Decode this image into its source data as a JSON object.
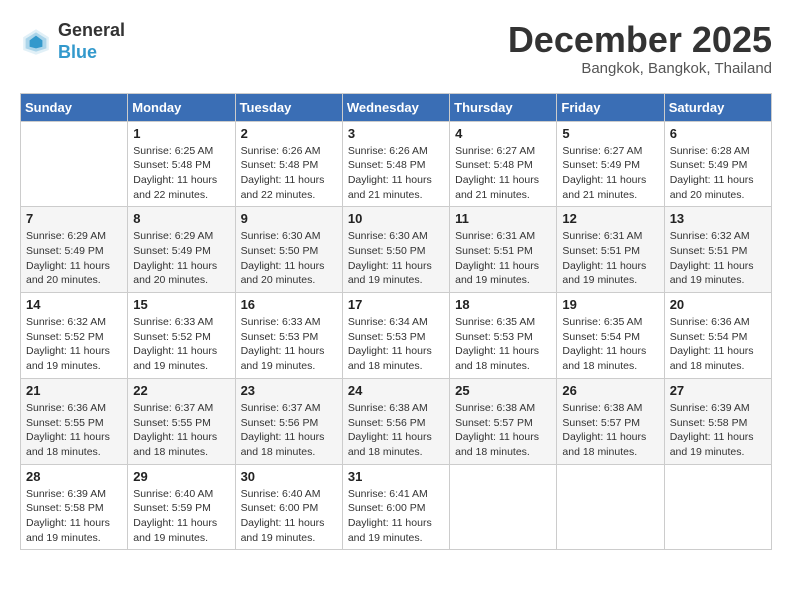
{
  "header": {
    "logo_general": "General",
    "logo_blue": "Blue",
    "title": "December 2025",
    "location": "Bangkok, Bangkok, Thailand"
  },
  "calendar": {
    "days_of_week": [
      "Sunday",
      "Monday",
      "Tuesday",
      "Wednesday",
      "Thursday",
      "Friday",
      "Saturday"
    ],
    "weeks": [
      [
        {
          "num": "",
          "info": ""
        },
        {
          "num": "1",
          "info": "Sunrise: 6:25 AM\nSunset: 5:48 PM\nDaylight: 11 hours\nand 22 minutes."
        },
        {
          "num": "2",
          "info": "Sunrise: 6:26 AM\nSunset: 5:48 PM\nDaylight: 11 hours\nand 22 minutes."
        },
        {
          "num": "3",
          "info": "Sunrise: 6:26 AM\nSunset: 5:48 PM\nDaylight: 11 hours\nand 21 minutes."
        },
        {
          "num": "4",
          "info": "Sunrise: 6:27 AM\nSunset: 5:48 PM\nDaylight: 11 hours\nand 21 minutes."
        },
        {
          "num": "5",
          "info": "Sunrise: 6:27 AM\nSunset: 5:49 PM\nDaylight: 11 hours\nand 21 minutes."
        },
        {
          "num": "6",
          "info": "Sunrise: 6:28 AM\nSunset: 5:49 PM\nDaylight: 11 hours\nand 20 minutes."
        }
      ],
      [
        {
          "num": "7",
          "info": "Sunrise: 6:29 AM\nSunset: 5:49 PM\nDaylight: 11 hours\nand 20 minutes."
        },
        {
          "num": "8",
          "info": "Sunrise: 6:29 AM\nSunset: 5:49 PM\nDaylight: 11 hours\nand 20 minutes."
        },
        {
          "num": "9",
          "info": "Sunrise: 6:30 AM\nSunset: 5:50 PM\nDaylight: 11 hours\nand 20 minutes."
        },
        {
          "num": "10",
          "info": "Sunrise: 6:30 AM\nSunset: 5:50 PM\nDaylight: 11 hours\nand 19 minutes."
        },
        {
          "num": "11",
          "info": "Sunrise: 6:31 AM\nSunset: 5:51 PM\nDaylight: 11 hours\nand 19 minutes."
        },
        {
          "num": "12",
          "info": "Sunrise: 6:31 AM\nSunset: 5:51 PM\nDaylight: 11 hours\nand 19 minutes."
        },
        {
          "num": "13",
          "info": "Sunrise: 6:32 AM\nSunset: 5:51 PM\nDaylight: 11 hours\nand 19 minutes."
        }
      ],
      [
        {
          "num": "14",
          "info": "Sunrise: 6:32 AM\nSunset: 5:52 PM\nDaylight: 11 hours\nand 19 minutes."
        },
        {
          "num": "15",
          "info": "Sunrise: 6:33 AM\nSunset: 5:52 PM\nDaylight: 11 hours\nand 19 minutes."
        },
        {
          "num": "16",
          "info": "Sunrise: 6:33 AM\nSunset: 5:53 PM\nDaylight: 11 hours\nand 19 minutes."
        },
        {
          "num": "17",
          "info": "Sunrise: 6:34 AM\nSunset: 5:53 PM\nDaylight: 11 hours\nand 18 minutes."
        },
        {
          "num": "18",
          "info": "Sunrise: 6:35 AM\nSunset: 5:53 PM\nDaylight: 11 hours\nand 18 minutes."
        },
        {
          "num": "19",
          "info": "Sunrise: 6:35 AM\nSunset: 5:54 PM\nDaylight: 11 hours\nand 18 minutes."
        },
        {
          "num": "20",
          "info": "Sunrise: 6:36 AM\nSunset: 5:54 PM\nDaylight: 11 hours\nand 18 minutes."
        }
      ],
      [
        {
          "num": "21",
          "info": "Sunrise: 6:36 AM\nSunset: 5:55 PM\nDaylight: 11 hours\nand 18 minutes."
        },
        {
          "num": "22",
          "info": "Sunrise: 6:37 AM\nSunset: 5:55 PM\nDaylight: 11 hours\nand 18 minutes."
        },
        {
          "num": "23",
          "info": "Sunrise: 6:37 AM\nSunset: 5:56 PM\nDaylight: 11 hours\nand 18 minutes."
        },
        {
          "num": "24",
          "info": "Sunrise: 6:38 AM\nSunset: 5:56 PM\nDaylight: 11 hours\nand 18 minutes."
        },
        {
          "num": "25",
          "info": "Sunrise: 6:38 AM\nSunset: 5:57 PM\nDaylight: 11 hours\nand 18 minutes."
        },
        {
          "num": "26",
          "info": "Sunrise: 6:38 AM\nSunset: 5:57 PM\nDaylight: 11 hours\nand 18 minutes."
        },
        {
          "num": "27",
          "info": "Sunrise: 6:39 AM\nSunset: 5:58 PM\nDaylight: 11 hours\nand 19 minutes."
        }
      ],
      [
        {
          "num": "28",
          "info": "Sunrise: 6:39 AM\nSunset: 5:58 PM\nDaylight: 11 hours\nand 19 minutes."
        },
        {
          "num": "29",
          "info": "Sunrise: 6:40 AM\nSunset: 5:59 PM\nDaylight: 11 hours\nand 19 minutes."
        },
        {
          "num": "30",
          "info": "Sunrise: 6:40 AM\nSunset: 6:00 PM\nDaylight: 11 hours\nand 19 minutes."
        },
        {
          "num": "31",
          "info": "Sunrise: 6:41 AM\nSunset: 6:00 PM\nDaylight: 11 hours\nand 19 minutes."
        },
        {
          "num": "",
          "info": ""
        },
        {
          "num": "",
          "info": ""
        },
        {
          "num": "",
          "info": ""
        }
      ]
    ]
  }
}
